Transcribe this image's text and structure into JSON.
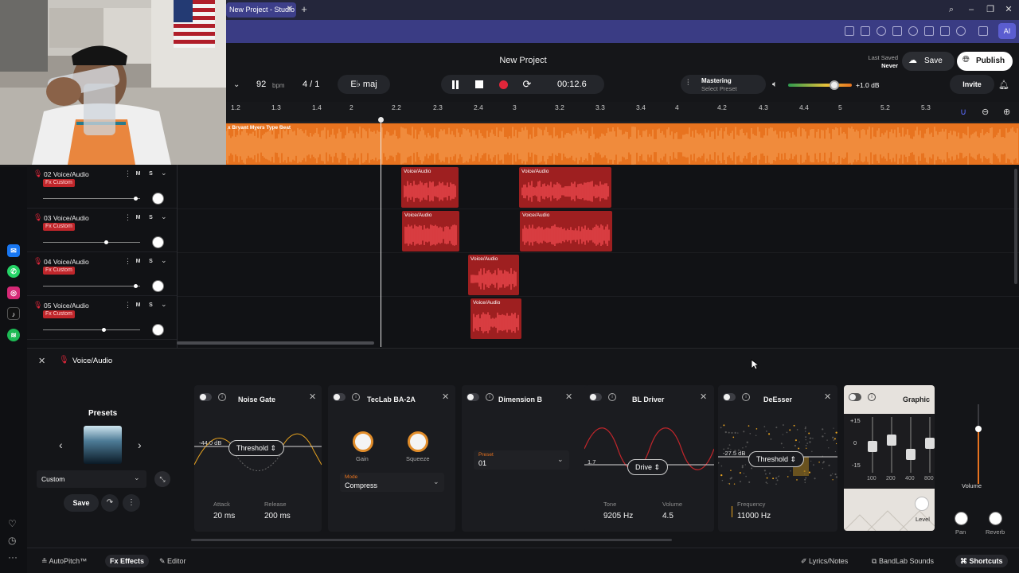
{
  "browser": {
    "tab_title": "New Project - Studio",
    "ai_label": "AI"
  },
  "header": {
    "project_title": "New Project",
    "tempo": "92",
    "tempo_unit": "bpm",
    "time_signature": "4 / 1",
    "key": "E♭ maj",
    "time": "00:12.6",
    "mastering_label": "Mastering",
    "mastering_preset": "Select Preset",
    "master_volume": "+1.0 dB",
    "master_volume_level": 0.72,
    "last_saved_label": "Last Saved",
    "last_saved_value": "Never",
    "save_label": "Save",
    "publish_label": "Publish",
    "invite_label": "Invite"
  },
  "ruler": {
    "ticks": [
      "1.2",
      "1.3",
      "1.4",
      "2",
      "2.2",
      "2.3",
      "2.4",
      "3",
      "3.2",
      "3.3",
      "3.4",
      "4",
      "4.2",
      "4.3",
      "4.4",
      "5",
      "5.2",
      "5.3"
    ]
  },
  "beat_track": {
    "label": "x Bryant Myers Type Beat"
  },
  "tracks": [
    {
      "name": "02 Voice/Audio",
      "fx": "Fx Custom",
      "m": "M",
      "s": "S",
      "volume": 0.95
    },
    {
      "name": "03 Voice/Audio",
      "fx": "Fx Custom",
      "m": "M",
      "s": "S",
      "volume": 0.65
    },
    {
      "name": "04 Voice/Audio",
      "fx": "Fx Custom",
      "m": "M",
      "s": "S",
      "volume": 0.95
    },
    {
      "name": "05 Voice/Audio",
      "fx": "Fx Custom",
      "m": "M",
      "s": "S",
      "volume": 0.62
    }
  ],
  "clip_label": "Voice/Audio",
  "fx_panel": {
    "title": "Voice/Audio",
    "presets_label": "Presets",
    "preset_value": "Custom",
    "save_label": "Save",
    "noise_gate": {
      "title": "Noise Gate",
      "db": "-44.0 dB",
      "chip": "Threshold",
      "attack_label": "Attack",
      "attack": "20 ms",
      "release_label": "Release",
      "release": "200 ms"
    },
    "teclab": {
      "title": "TecLab BA-2A",
      "gain_label": "Gain",
      "squeeze_label": "Squeeze",
      "mode_label": "Mode",
      "mode_value": "Compress"
    },
    "dimension": {
      "title": "Dimension B",
      "preset_label": "Preset",
      "preset_value": "01"
    },
    "bl_driver": {
      "title": "BL Driver",
      "db": "1.7",
      "chip": "Drive",
      "tone_label": "Tone",
      "tone": "9205 Hz",
      "volume_label": "Volume",
      "volume": "4.5"
    },
    "deesser": {
      "title": "DeEsser",
      "db": "-27.5 dB",
      "chip": "Threshold",
      "freq_label": "Frequency",
      "freq": "11000 Hz"
    },
    "graphic": {
      "title": "Graphic",
      "scale": [
        "+15",
        "0",
        "-15"
      ],
      "bands": [
        "100",
        "200",
        "400",
        "800"
      ],
      "level_label": "Level"
    },
    "volume_label": "Volume",
    "pan_label": "Pan",
    "reverb_label": "Reverb"
  },
  "bottombar": {
    "autopitch": "AutoPitch™",
    "effects": "Effects",
    "editor": "Editor",
    "lyrics": "Lyrics/Notes",
    "sounds": "BandLab Sounds",
    "shortcuts": "Shortcuts"
  },
  "colors": {
    "accent_orange": "#e8731f",
    "clip_red": "#c0262b",
    "record_red": "#e0263a",
    "browser_purple": "#3a3c84"
  }
}
